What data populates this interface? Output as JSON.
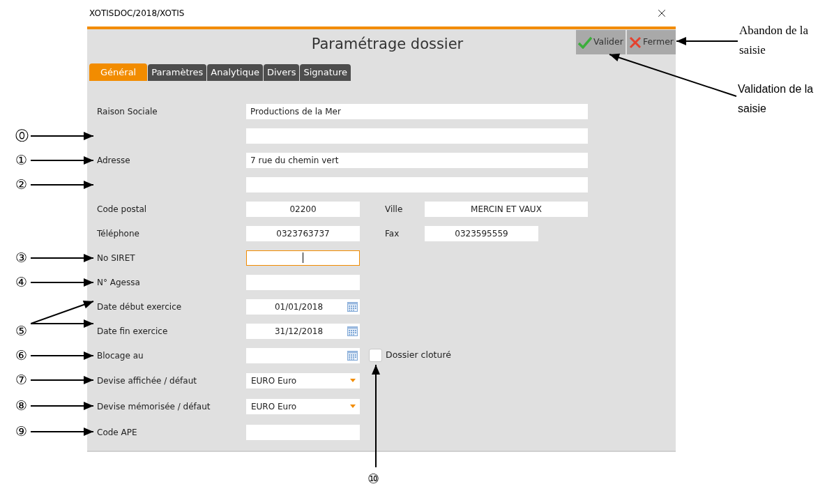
{
  "window": {
    "title": "XOTISDOC/2018/XOTIS"
  },
  "dialog": {
    "title": "Paramétrage dossier"
  },
  "buttons": [
    {
      "label": "Valider",
      "kind": "validate"
    },
    {
      "label": "Fermer",
      "kind": "close"
    }
  ],
  "notes": [
    {
      "text": "Abandon de la saisie",
      "kind": "close"
    },
    {
      "text": "Validation de la saisie",
      "kind": "validate"
    }
  ],
  "tabs": [
    {
      "label": "Général",
      "selected": true
    },
    {
      "label": "Paramètres",
      "selected": false
    },
    {
      "label": "Analytique",
      "selected": false
    },
    {
      "label": "Divers",
      "selected": false
    },
    {
      "label": "Signature",
      "selected": false
    }
  ],
  "rows": [
    {
      "label": "Raison Sociale",
      "field": {
        "kind": "long",
        "value": "Productions de la Mer",
        "focused": false
      }
    },
    {
      "marker": {
        "text": "⓪",
        "kind": "single"
      },
      "field": {
        "kind": "long",
        "focused": false
      }
    },
    {
      "label": "Adresse",
      "marker": {
        "text": "①",
        "kind": "single"
      },
      "field": {
        "kind": "long",
        "value": "7 rue du chemin vert",
        "focused": false
      }
    },
    {
      "marker": {
        "text": "②",
        "kind": "single"
      },
      "field": {
        "kind": "long",
        "focused": false
      }
    },
    {
      "label": "Code postal",
      "field": {
        "kind": "number",
        "value": "02200",
        "focused": false
      },
      "second": {
        "label": "Ville",
        "field": {
          "kind": "city",
          "value": "MERCIN ET VAUX",
          "focused": false
        }
      }
    },
    {
      "label": "Téléphone",
      "field": {
        "kind": "number",
        "value": "0323763737",
        "focused": false
      },
      "second": {
        "label": "Fax",
        "field": {
          "kind": "number",
          "value": "0323595559",
          "focused": false
        }
      }
    },
    {
      "label": "No SIRET",
      "marker": {
        "text": "③",
        "kind": "single"
      },
      "field": {
        "kind": "number",
        "focused": true
      }
    },
    {
      "label": "N° Agessa",
      "marker": {
        "text": "④",
        "kind": "single"
      },
      "field": {
        "kind": "short",
        "focused": false
      }
    },
    {
      "label": "Date début exercice",
      "field": {
        "kind": "date",
        "value": "01/01/2018",
        "focused": false
      }
    },
    {
      "label": "Date fin exercice",
      "marker": {
        "text": "⑤",
        "kind": "double"
      },
      "field": {
        "kind": "date",
        "value": "31/12/2018",
        "focused": false
      }
    },
    {
      "label": "Blocage au",
      "marker": {
        "text": "⑥",
        "kind": "single"
      },
      "field": {
        "kind": "date",
        "focused": false
      },
      "checkbox": {
        "label": "Dossier cloturé",
        "checked": false,
        "marker": "⑩"
      }
    },
    {
      "label": "Devise affichée / défaut",
      "marker": {
        "text": "⑦",
        "kind": "single"
      },
      "field": {
        "kind": "select",
        "value": "EURO Euro",
        "focused": false
      }
    },
    {
      "label": "Devise mémorisée / défaut",
      "marker": {
        "text": "⑧",
        "kind": "single"
      },
      "field": {
        "kind": "select",
        "value": "EURO Euro",
        "focused": false
      }
    },
    {
      "label": "Code APE",
      "marker": {
        "text": "⑨",
        "kind": "single"
      },
      "field": {
        "kind": "short",
        "focused": false
      }
    }
  ]
}
